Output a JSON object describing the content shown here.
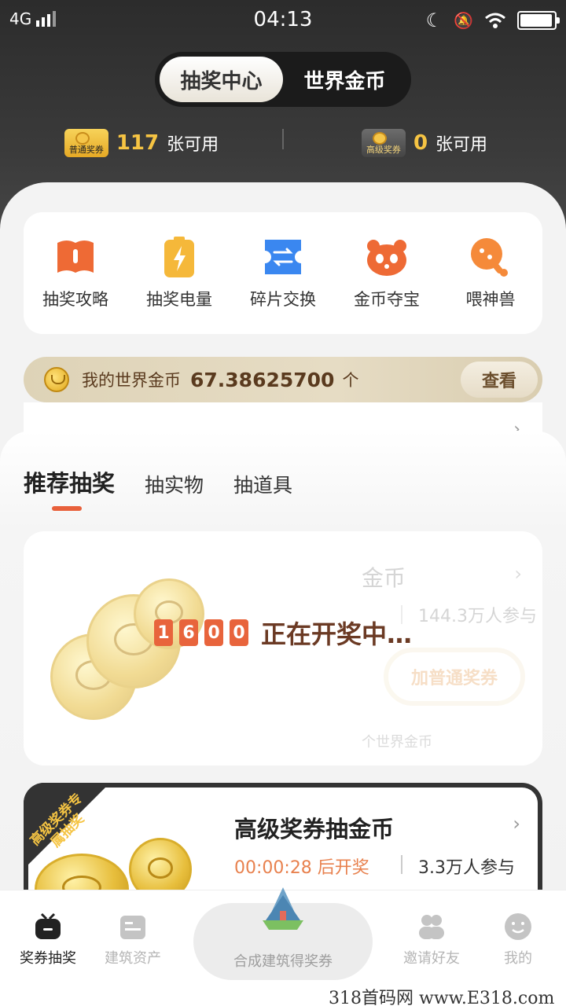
{
  "status_bar": {
    "network": "4G",
    "time": "04:13"
  },
  "segment": {
    "tabs": [
      "抽奖中心",
      "世界金币"
    ],
    "active_index": 0
  },
  "tickets": {
    "normal": {
      "icon_label": "普通奖券",
      "count": "117",
      "suffix": "张可用"
    },
    "senior": {
      "icon_label": "高级奖券",
      "count": "0",
      "suffix": "张可用"
    }
  },
  "quick_actions": [
    {
      "label": "抽奖攻略",
      "icon": "book-icon",
      "color": "#ee6a35"
    },
    {
      "label": "抽奖电量",
      "icon": "battery-icon",
      "color": "#f5b83a"
    },
    {
      "label": "碎片交换",
      "icon": "exchange-icon",
      "color": "#3a87f0"
    },
    {
      "label": "金币夺宝",
      "icon": "panda-icon",
      "color": "#ee6a35"
    },
    {
      "label": "喂神兽",
      "icon": "drumstick-icon",
      "color": "#f58a3a"
    }
  ],
  "coin_bar": {
    "label": "我的世界金币",
    "amount": "67.38625700",
    "unit": "个",
    "button": "查看"
  },
  "tabs": {
    "items": [
      "推荐抽奖",
      "抽实物",
      "抽道具"
    ],
    "active_index": 0
  },
  "lottery_card_1": {
    "title_fragment": "金币",
    "participants": "144.3万人参与",
    "button": "加普通奖券",
    "footer_fragment": "个世界金币",
    "drawing_digits": [
      "1",
      "6",
      "0",
      "0"
    ],
    "drawing_text": "正在开奖中…"
  },
  "lottery_card_2": {
    "badge": "高级奖券专属抽奖",
    "title": "高级奖券抽金币",
    "timer": "00:00:28 后开奖",
    "participants": "3.3万人参与"
  },
  "bottom_nav": {
    "items": [
      {
        "label": "奖券抽奖",
        "icon": "tv-icon"
      },
      {
        "label": "建筑资产",
        "icon": "building-asset-icon"
      },
      {
        "label": "合成建筑得奖券",
        "icon": "tower-icon"
      },
      {
        "label": "邀请好友",
        "icon": "people-icon"
      },
      {
        "label": "我的",
        "icon": "smile-icon"
      }
    ],
    "active_index": 0
  },
  "watermark": "318首码网 www.E318.com"
}
